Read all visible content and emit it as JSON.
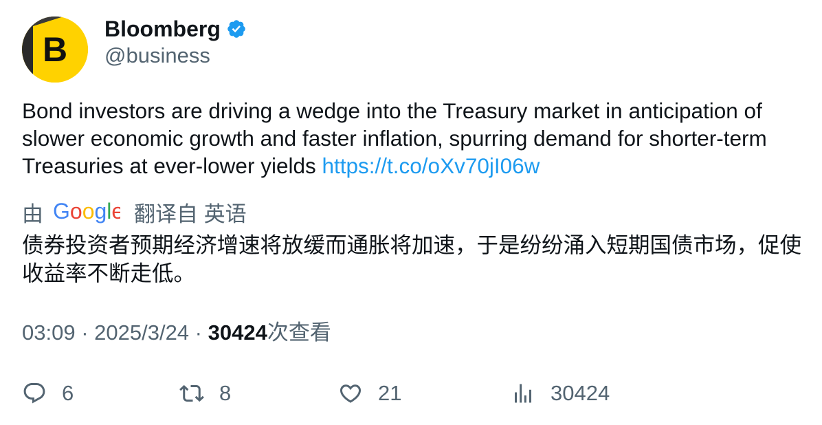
{
  "author": {
    "display_name": "Bloomberg",
    "handle": "@business",
    "avatar_letter": "B",
    "avatar_color": "#ffd200",
    "verified": true,
    "verified_color": "#1d9bf0"
  },
  "tweet": {
    "text": "Bond investors are driving a wedge into the Treasury market in anticipation of slower economic growth and faster inflation, spurring demand for shorter-term Treasuries at ever-lower yields ",
    "link_text": "https://t.co/oXv70jI06w"
  },
  "translation": {
    "by_label": "由",
    "provider": "Google",
    "label": "翻译自 英语",
    "text": "债券投资者预期经济增速将放缓而通胀将加速，于是纷纷涌入短期国债市场，促使收益率不断走低。"
  },
  "meta": {
    "time": "03:09",
    "separator": " · ",
    "date": "2025/3/24",
    "views_count": "30424",
    "views_label": "次查看"
  },
  "actions": {
    "replies": "6",
    "retweets": "8",
    "likes": "21",
    "views": "30424"
  },
  "colors": {
    "text_primary": "#0f1419",
    "text_secondary": "#536471",
    "link": "#1d9bf0"
  }
}
